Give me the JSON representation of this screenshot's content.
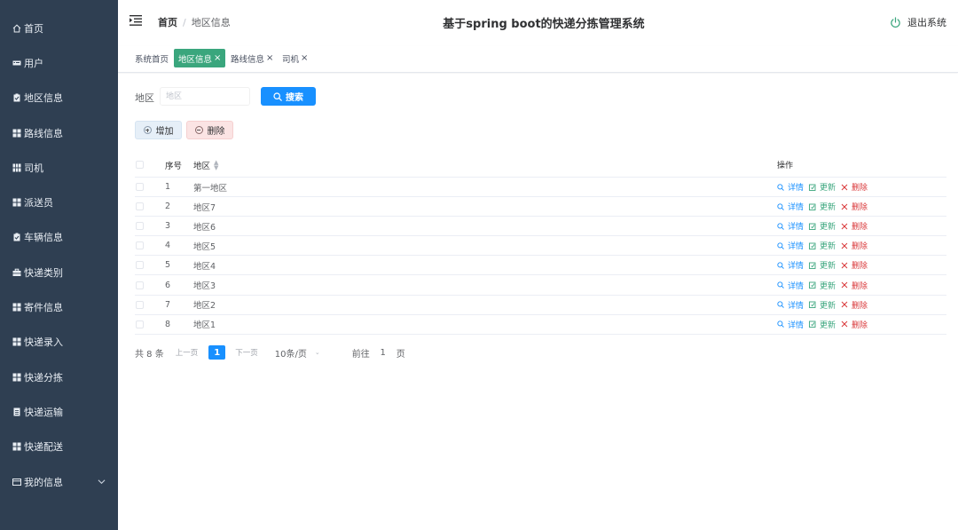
{
  "sidebar": {
    "items": [
      {
        "label": "首页",
        "icon": "home-icon"
      },
      {
        "label": "用户",
        "icon": "user-card-icon"
      },
      {
        "label": "地区信息",
        "icon": "clipboard-icon"
      },
      {
        "label": "路线信息",
        "icon": "grid-icon"
      },
      {
        "label": "司机",
        "icon": "grid-dense-icon"
      },
      {
        "label": "派送员",
        "icon": "grid-icon"
      },
      {
        "label": "车辆信息",
        "icon": "clipboard-icon"
      },
      {
        "label": "快递类别",
        "icon": "briefcase-icon"
      },
      {
        "label": "寄件信息",
        "icon": "grid-icon"
      },
      {
        "label": "快递录入",
        "icon": "grid-icon"
      },
      {
        "label": "快递分拣",
        "icon": "grid-icon"
      },
      {
        "label": "快递运输",
        "icon": "document-icon"
      },
      {
        "label": "快递配送",
        "icon": "grid-icon"
      },
      {
        "label": "我的信息",
        "icon": "card-icon"
      }
    ]
  },
  "header": {
    "breadcrumb_home": "首页",
    "breadcrumb_sep": "/",
    "breadcrumb_current": "地区信息",
    "title": "基于spring boot的快递分拣管理系统",
    "logout_label": "退出系统"
  },
  "tags": [
    {
      "label": "系统首页",
      "active": false,
      "closable": false
    },
    {
      "label": "地区信息",
      "active": true,
      "closable": true
    },
    {
      "label": "路线信息",
      "active": false,
      "closable": true
    },
    {
      "label": "司机",
      "active": false,
      "closable": true
    }
  ],
  "search": {
    "label": "地区",
    "placeholder": "地区",
    "button_label": "搜索"
  },
  "actions": {
    "add_label": "增加",
    "delete_label": "删除"
  },
  "table": {
    "columns": {
      "index": "序号",
      "area": "地区",
      "ops": "操作"
    },
    "op_labels": {
      "view": "详情",
      "edit": "更新",
      "delete": "删除"
    },
    "rows": [
      {
        "index": "1",
        "area": "第一地区"
      },
      {
        "index": "2",
        "area": "地区7"
      },
      {
        "index": "3",
        "area": "地区6"
      },
      {
        "index": "4",
        "area": "地区5"
      },
      {
        "index": "5",
        "area": "地区4"
      },
      {
        "index": "6",
        "area": "地区3"
      },
      {
        "index": "7",
        "area": "地区2"
      },
      {
        "index": "8",
        "area": "地区1"
      }
    ]
  },
  "pagination": {
    "total": "共 8 条",
    "prev": "上一页",
    "current_page": "1",
    "next": "下一页",
    "page_size": "10条/页",
    "goto_label": "前往",
    "goto_value": "1",
    "goto_suffix": "页"
  },
  "colors": {
    "sidebar_bg": "#2f3f52",
    "active_tag": "#3aa67d",
    "primary": "#1890ff",
    "danger": "#d9383a"
  }
}
